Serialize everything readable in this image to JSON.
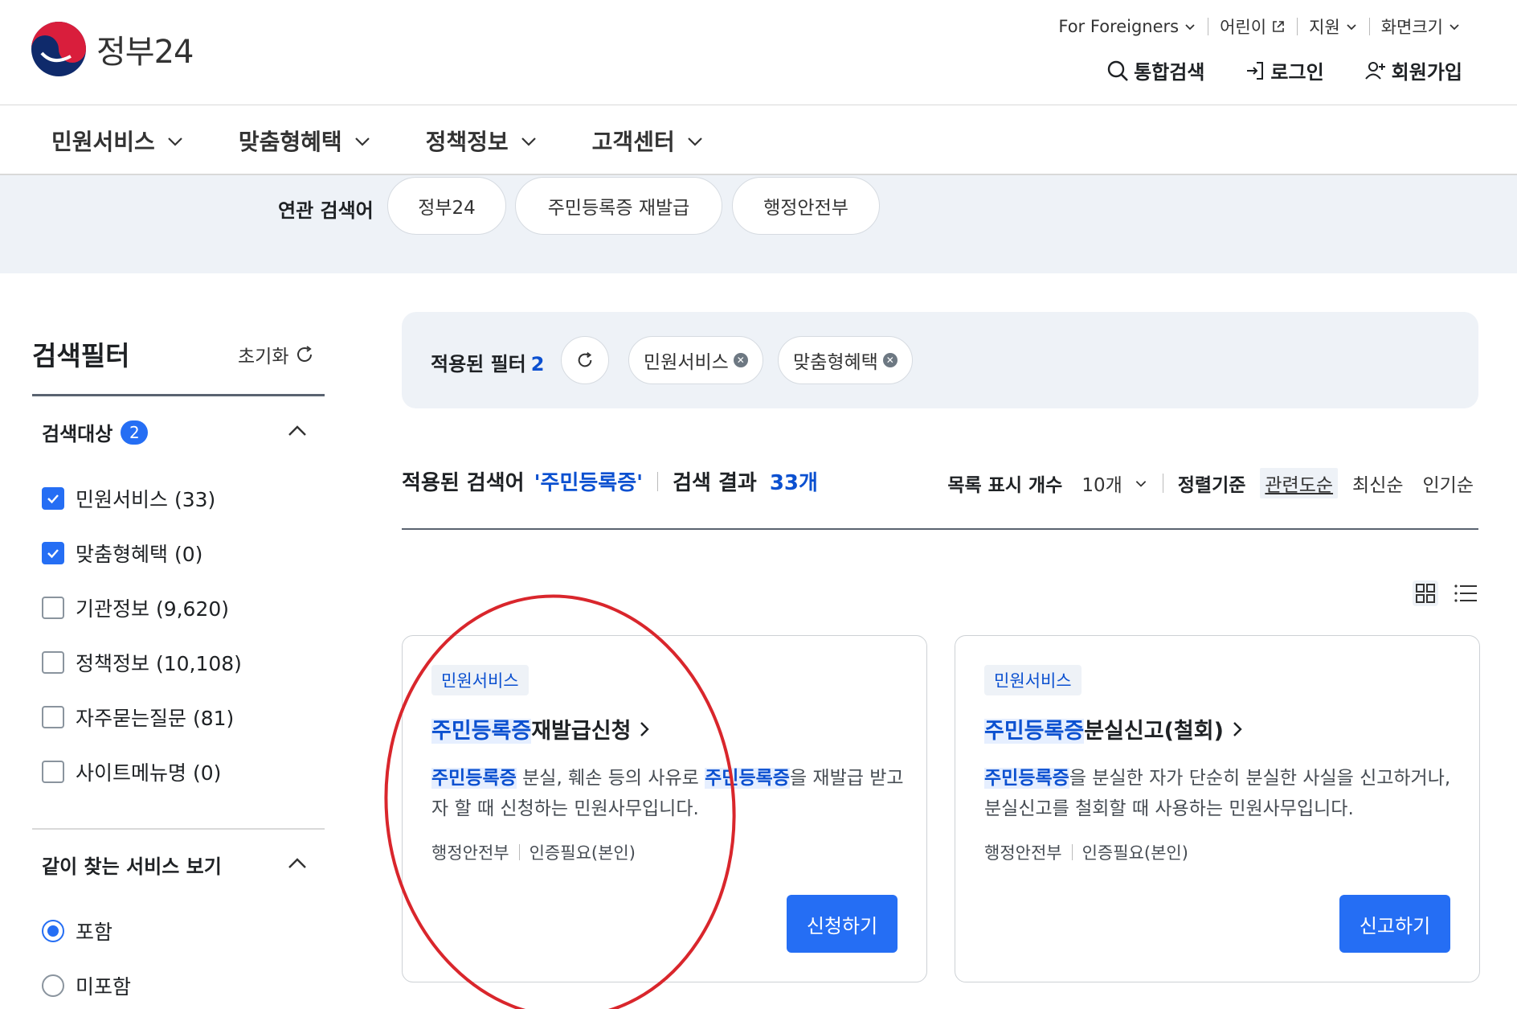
{
  "header": {
    "logo_text": "정부24",
    "util": [
      {
        "label": "For Foreigners",
        "icon": "chevron-down-icon"
      },
      {
        "label": "어린이",
        "icon": "external-link-icon"
      },
      {
        "label": "지원",
        "icon": "chevron-down-icon"
      },
      {
        "label": "화면크기",
        "icon": "chevron-down-icon"
      }
    ],
    "actions": {
      "search": "통합검색",
      "login": "로그인",
      "signup": "회원가입"
    }
  },
  "gnb": [
    "민원서비스",
    "맞춤형혜택",
    "정책정보",
    "고객센터"
  ],
  "related": {
    "label": "연관 검색어",
    "chips": [
      "정부24",
      "주민등록증 재발급",
      "행정안전부"
    ]
  },
  "sidebar": {
    "title": "검색필터",
    "reset": "초기화",
    "target": {
      "title": "검색대상",
      "count": "2",
      "items": [
        {
          "label": "민원서비스 (33)",
          "checked": true
        },
        {
          "label": "맞춤형혜택 (0)",
          "checked": true
        },
        {
          "label": "기관정보 (9,620)",
          "checked": false
        },
        {
          "label": "정책정보 (10,108)",
          "checked": false
        },
        {
          "label": "자주묻는질문 (81)",
          "checked": false
        },
        {
          "label": "사이트메뉴명 (0)",
          "checked": false
        }
      ]
    },
    "together": {
      "title": "같이 찾는 서비스 보기",
      "options": [
        {
          "label": "포함",
          "selected": true
        },
        {
          "label": "미포함",
          "selected": false
        }
      ]
    }
  },
  "applied_filter": {
    "label": "적용된 필터",
    "count": "2",
    "chips": [
      "민원서비스",
      "맞춤형혜택"
    ]
  },
  "results": {
    "keyword_label": "적용된 검색어",
    "keyword": "'주민등록증'",
    "count_label": "검색 결과",
    "count": "33개",
    "page_size_label": "목록 표시 개수",
    "page_size": "10개",
    "sort_label": "정렬기준",
    "sorts": [
      "관련도순",
      "최신순",
      "인기순"
    ],
    "active_sort": "관련도순"
  },
  "cards": [
    {
      "tag": "민원서비스",
      "title_hl": "주민등록증",
      "title_rest": "재발급신청",
      "desc_hl1": "주민등록증",
      "desc_mid": " 분실, 훼손 등의 사유로 ",
      "desc_hl2": "주민등록증",
      "desc_rest": "을 재발급 받고자 할 때 신청하는 민원사무입니다.",
      "org": "행정안전부",
      "auth": "인증필요(본인)",
      "button": "신청하기"
    },
    {
      "tag": "민원서비스",
      "title_hl": "주민등록증",
      "title_rest": "분실신고(철회)",
      "desc_hl1": "주민등록증",
      "desc_mid": "을 분실한 자가 단순히 분실한 사실을 신고하거나, 분실신고를 철회할 때 사용하는 민원사무입니다.",
      "desc_hl2": "",
      "desc_rest": "",
      "org": "행정안전부",
      "auth": "인증필요(본인)",
      "button": "신고하기"
    }
  ],
  "colors": {
    "primary": "#256ef4",
    "highlight_text": "#0b50d0",
    "panel_bg": "#eef2f7",
    "annotation": "#d9262c"
  }
}
